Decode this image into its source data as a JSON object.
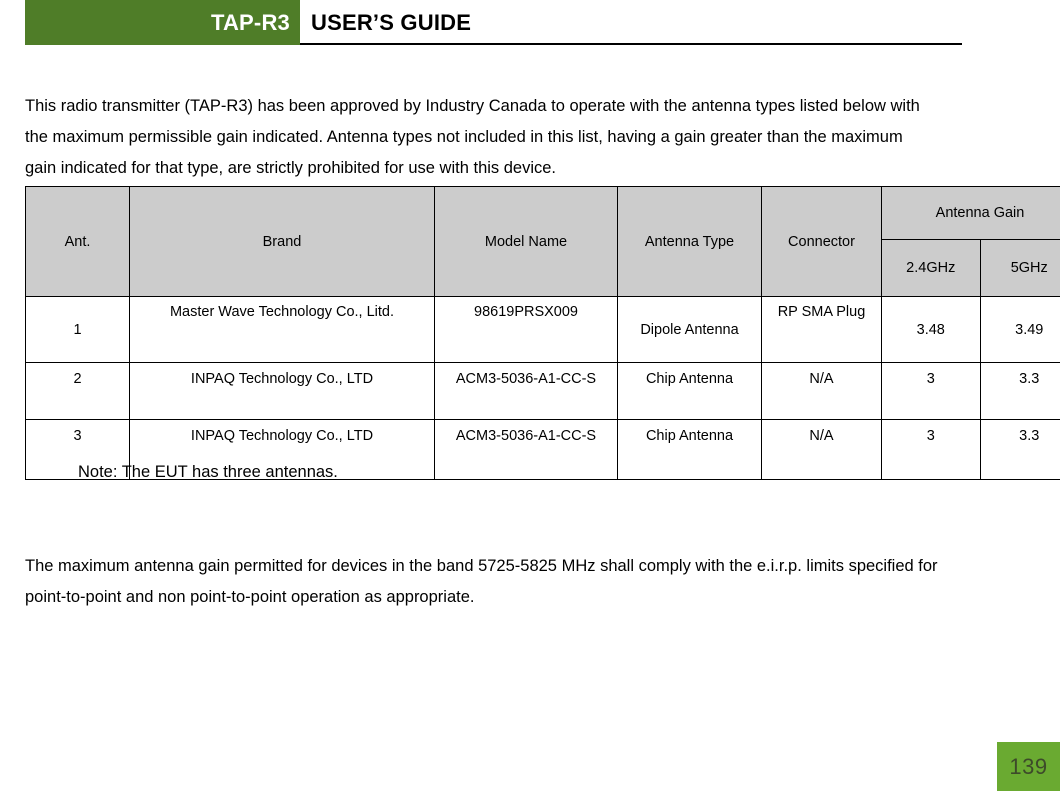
{
  "header": {
    "product": "TAP-R3",
    "guide_title": "USER’S GUIDE",
    "band_color": "#4f7d28"
  },
  "intro_paragraph": "This radio transmitter (TAP-R3) has been approved by Industry Canada to operate with the antenna types listed below with the maximum permissible gain indicated. Antenna types not included in this list, having a gain greater than the maximum gain indicated for that type, are strictly prohibited for use with this device.",
  "table": {
    "header_bg": "#cccccc",
    "columns": {
      "ant": "Ant.",
      "brand": "Brand",
      "model_name": "Model Name",
      "antenna_type": "Antenna Type",
      "connector": "Connector",
      "antenna_gain": "Antenna Gain",
      "gain_24ghz": "2.4GHz",
      "gain_5ghz": "5GHz"
    },
    "rows": [
      {
        "ant": "1",
        "brand": "Master Wave Technology Co., Litd.",
        "model_name": "98619PRSX009",
        "antenna_type": "Dipole Antenna",
        "connector": "RP SMA Plug",
        "gain_24ghz": "3.48",
        "gain_5ghz": "3.49"
      },
      {
        "ant": "2",
        "brand": "INPAQ Technology Co., LTD",
        "model_name": "ACM3-5036-A1-CC-S",
        "antenna_type": "Chip Antenna",
        "connector": "N/A",
        "gain_24ghz": "3",
        "gain_5ghz": "3.3"
      },
      {
        "ant": "3",
        "brand": "INPAQ Technology Co., LTD",
        "model_name": "ACM3-5036-A1-CC-S",
        "antenna_type": "Chip Antenna",
        "connector": "N/A",
        "gain_24ghz": "3",
        "gain_5ghz": "3.3"
      }
    ]
  },
  "note": "Note: The EUT has three antennas.",
  "closing_paragraph": "The maximum antenna gain permitted for devices in the band 5725-5825 MHz shall comply with the e.i.r.p. limits specified for point-to-point and non point-to-point operation as appropriate.",
  "footer": {
    "page_number": "139",
    "block_color": "#6aaa31"
  }
}
